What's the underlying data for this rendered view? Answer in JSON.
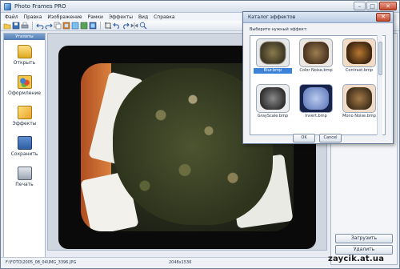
{
  "window": {
    "title": "Photo Frames PRO"
  },
  "menu": {
    "items": [
      "Файл",
      "Правка",
      "Изображение",
      "Рамки",
      "Эффекты",
      "Вид",
      "Справка"
    ]
  },
  "toolbar": {
    "icons": [
      "open-icon",
      "save-icon",
      "print-icon",
      "copy-icon",
      "undo-icon",
      "redo-icon",
      "frame-icon",
      "effect-icon",
      "crop-icon",
      "rotate-icon",
      "zoom-icon"
    ]
  },
  "left_panel": {
    "header": "Утилиты",
    "items": [
      {
        "label": "Открыть",
        "icon": "folder-icon"
      },
      {
        "label": "Оформление",
        "icon": "frame-decor-icon"
      },
      {
        "label": "Эффекты",
        "icon": "effects-icon"
      },
      {
        "label": "Сохранить",
        "icon": "floppy-icon"
      },
      {
        "label": "Печать",
        "icon": "printer-icon"
      }
    ]
  },
  "right_panel": {
    "load_button": "Загрузить",
    "delete_button": "Удалить"
  },
  "status": {
    "path": "F:\\FOTO\\2005_08_04\\IMG_3396.JPG",
    "dimensions": "2048x1536"
  },
  "watermark": "zaycik.at.ua",
  "dialog": {
    "title": "Каталог эффектов",
    "prompt": "Выберите нужный эффект:",
    "effects": [
      {
        "label": "Blur.bmp",
        "selected": true
      },
      {
        "label": "Color Noise.bmp",
        "selected": false
      },
      {
        "label": "Contrast.bmp",
        "selected": false
      },
      {
        "label": "GrayScale.bmp",
        "selected": false
      },
      {
        "label": "Invert.bmp",
        "selected": false
      },
      {
        "label": "Mono Noise.bmp",
        "selected": false
      }
    ],
    "ok": "OK",
    "cancel": "Cancel"
  },
  "colors": {
    "accent": "#3b82d8",
    "title_bar": "#d6dfea",
    "close": "#c44a2e"
  }
}
